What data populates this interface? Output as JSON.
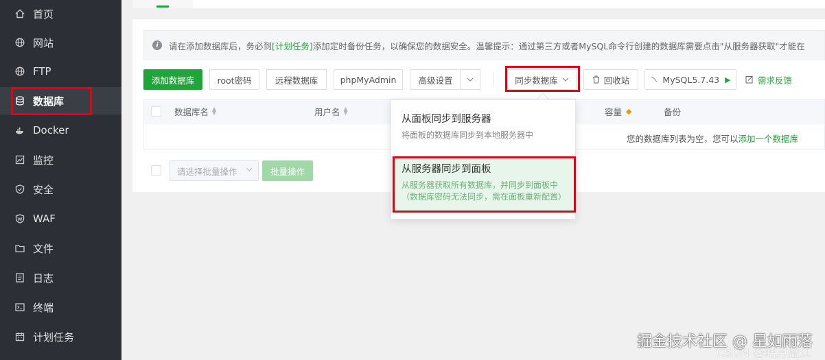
{
  "sidebar": {
    "items": [
      {
        "label": "首页",
        "icon": "home-icon"
      },
      {
        "label": "网站",
        "icon": "globe-icon"
      },
      {
        "label": "FTP",
        "icon": "globe-icon"
      },
      {
        "label": "数据库",
        "icon": "database-icon",
        "active": true
      },
      {
        "label": "Docker",
        "icon": "docker-icon"
      },
      {
        "label": "监控",
        "icon": "monitor-icon"
      },
      {
        "label": "安全",
        "icon": "shield-icon"
      },
      {
        "label": "WAF",
        "icon": "waf-shield-icon"
      },
      {
        "label": "文件",
        "icon": "folder-icon"
      },
      {
        "label": "日志",
        "icon": "log-icon"
      },
      {
        "label": "终端",
        "icon": "terminal-icon"
      },
      {
        "label": "计划任务",
        "icon": "calendar-icon"
      }
    ]
  },
  "notice": {
    "before": "请在添加数据库后，务必到",
    "link": "[计划任务]",
    "after": "添加定时备份任务，以确保您的数据安全。温馨提示：通过第三方或者MySQL命令行创建的数据库需要点击\"从服务器获取\"才能在"
  },
  "toolbar": {
    "add_db": "添加数据库",
    "root_pwd": "root密码",
    "remote_db": "远程数据库",
    "phpmyadmin": "phpMyAdmin",
    "advanced": "高级设置",
    "sync_db": "同步数据库",
    "recycle": "回收站",
    "mysql_version": "MySQL5.7.43",
    "feedback": "需求反馈"
  },
  "table": {
    "headers": {
      "name": "数据库名",
      "user": "用户名",
      "capacity": "容量",
      "backup": "备份"
    },
    "empty_before": "您的数据库列表为空，您可以",
    "empty_link": "添加一个数据库"
  },
  "batch": {
    "placeholder": "请选择批量操作",
    "button": "批量操作"
  },
  "dropdown": {
    "item1_title": "从面板同步到服务器",
    "item1_desc": "将面板的数据库同步到本地服务器中",
    "item2_title": "从服务器同步到面板",
    "item2_desc1": "从服务器获取所有数据库，并同步到面板中",
    "item2_desc2": "（数据库密码无法同步，需在面板重新配置）"
  },
  "watermark": {
    "main": "掘金技术社区 @ 星如雨落",
    "sub": "CSDN @皓月盈江"
  },
  "colors": {
    "accent": "#20a53a",
    "sidebar_bg": "#2c2f36",
    "highlight": "#e60012"
  }
}
